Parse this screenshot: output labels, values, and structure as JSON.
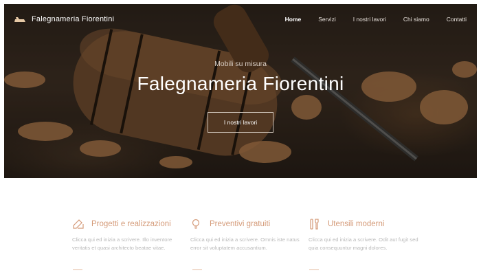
{
  "header": {
    "brand": "Falegnameria Fiorentini",
    "nav": [
      {
        "label": "Home",
        "active": true
      },
      {
        "label": "Servizi",
        "active": false
      },
      {
        "label": "I nostri lavori",
        "active": false
      },
      {
        "label": "Chi siamo",
        "active": false
      },
      {
        "label": "Contatti",
        "active": false
      }
    ]
  },
  "hero": {
    "subtitle": "Mobili su misura",
    "title": "Falegnameria Fiorentini",
    "button": "I nostri lavori"
  },
  "features": [
    {
      "icon": "pencil-ruler-icon",
      "title": "Progetti e realizzazioni",
      "text": "Clicca qui ed inizia a scrivere. Illo inventore veritatis et quasi architecto beatae vitae."
    },
    {
      "icon": "lightbulb-icon",
      "title": "Preventivi gratuiti",
      "text": "Clicca qui ed inizia a scrivere. Omnis iste natus error sit voluptatem accusantium."
    },
    {
      "icon": "tools-icon",
      "title": "Utensili moderni",
      "text": "Clicca qui ed inizia a scrivere. Odit aut fugit sed quia consequuntur magni dolores."
    }
  ],
  "colors": {
    "accent": "#d49a78",
    "body_text": "#b9b9b9",
    "hero_dark": "#2a211b"
  }
}
